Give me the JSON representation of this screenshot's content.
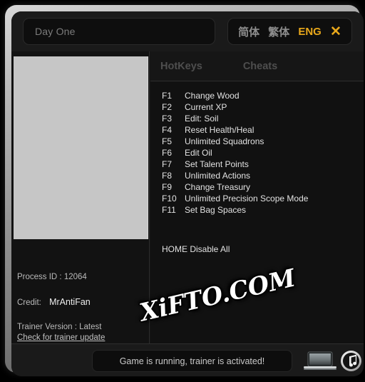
{
  "window": {
    "game_title": "Day One"
  },
  "language": {
    "options": [
      {
        "label": "简体",
        "active": false,
        "name": "lang-simplified-chinese"
      },
      {
        "label": "繁体",
        "active": false,
        "name": "lang-traditional-chinese"
      },
      {
        "label": "ENG",
        "active": true,
        "name": "lang-english"
      }
    ],
    "close_label": "✕",
    "accent_color": "#e9a81b"
  },
  "tabs": [
    {
      "label": "HotKeys",
      "name": "tab-hotkeys"
    },
    {
      "label": "Cheats",
      "name": "tab-cheats"
    }
  ],
  "hotkeys": [
    {
      "key": "F1",
      "label": "Change Wood"
    },
    {
      "key": "F2",
      "label": "Current XP"
    },
    {
      "key": "F3",
      "label": "Edit: Soil"
    },
    {
      "key": "F4",
      "label": "Reset Health/Heal"
    },
    {
      "key": "F5",
      "label": "Unlimited Squadrons"
    },
    {
      "key": "F6",
      "label": "Edit Oil"
    },
    {
      "key": "F7",
      "label": "Set Talent Points"
    },
    {
      "key": "F8",
      "label": "Unlimited Actions"
    },
    {
      "key": "F9",
      "label": "Change Treasury"
    },
    {
      "key": "F10",
      "label": "Unlimited Precision Scope Mode"
    },
    {
      "key": "F11",
      "label": "Set Bag Spaces"
    }
  ],
  "disable_all": "HOME Disable All",
  "info": {
    "process_id_label": "Process ID :",
    "process_id_value": "12064",
    "credit_label": "Credit:",
    "credit_value": "MrAntiFan",
    "version_label": "Trainer Version : Latest",
    "update_link": "Check for trainer update"
  },
  "status": {
    "message": "Game is running, trainer is activated!",
    "laptop_icon": "laptop-icon",
    "music_icon": "music-note-icon"
  },
  "watermark": {
    "text": "XiFTO.COM"
  }
}
